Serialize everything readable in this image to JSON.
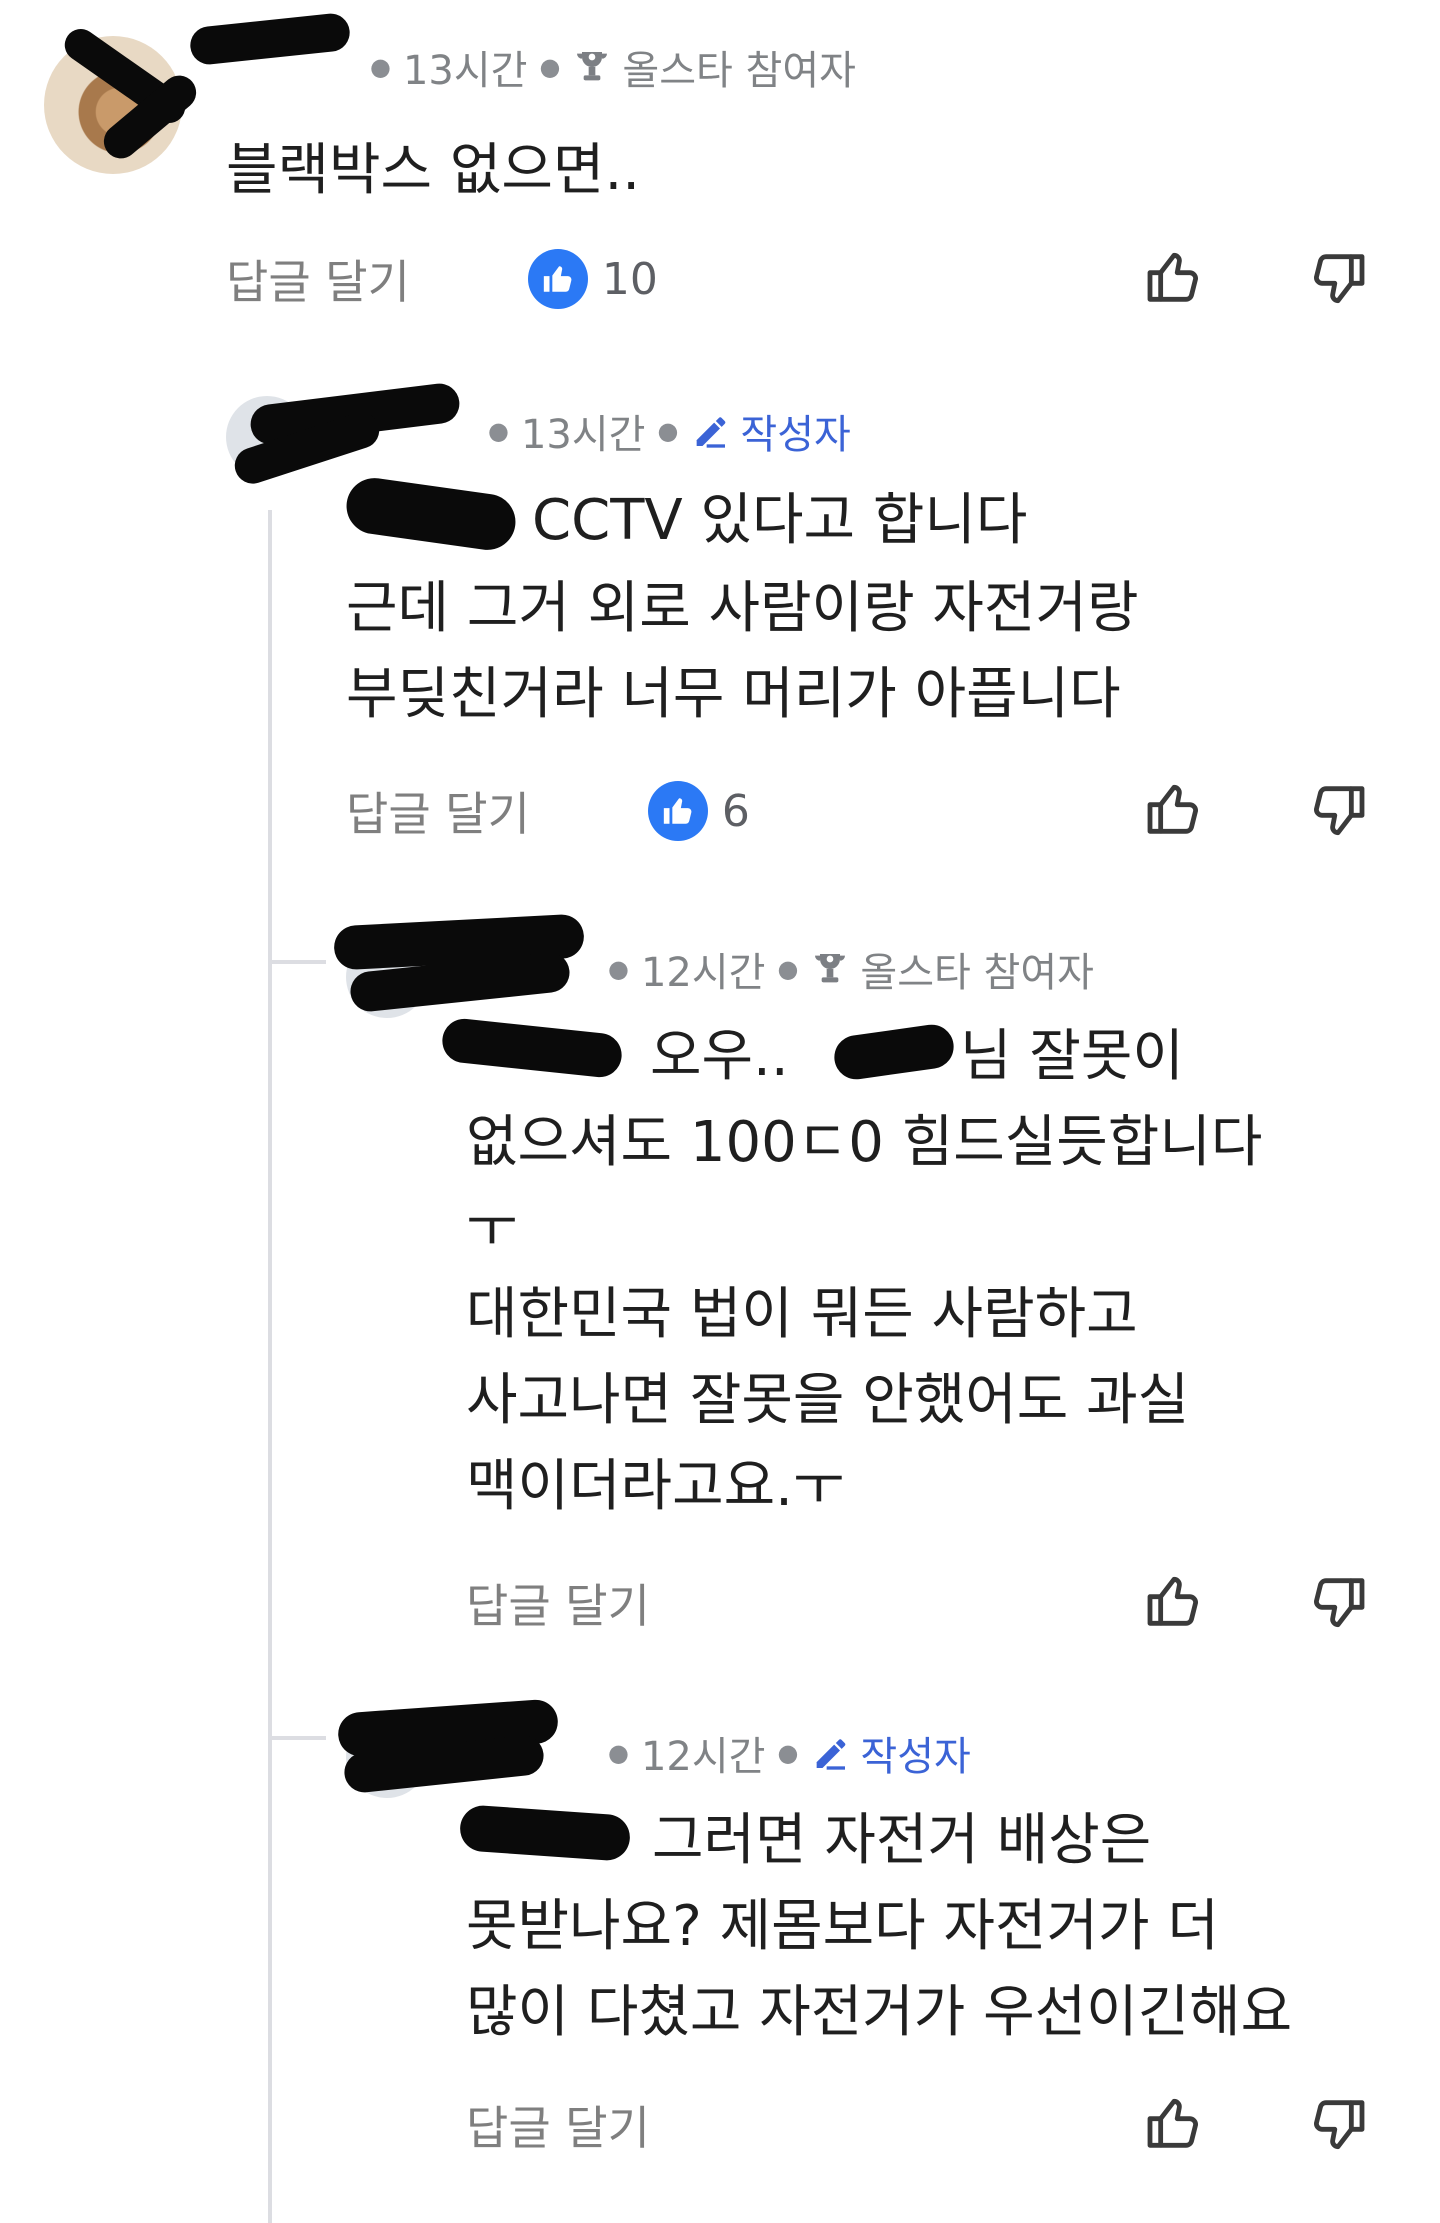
{
  "comments": [
    {
      "time": "13시간",
      "badge": "올스타 참여자",
      "text": "블랙박스 없으면..",
      "reply_label": "답글 달기",
      "likes": "10"
    },
    {
      "time": "13시간",
      "badge": "작성자",
      "mention": "",
      "text_line1": "CCTV 있다고 합니다￼",
      "text_rest": "근데 그거 외로 사람이랑 자전거랑\n부딪친거라 너무 머리가 아픕니다",
      "reply_label": "답글 달기",
      "likes": "6"
    },
    {
      "time": "12시간",
      "badge": "올스타 참여자",
      "text_line1": "오우..",
      "text_line1_suffix": "님 잘못이",
      "text_rest": "없으셔도 100ㄷ0 힘드실듯합니다\nㅜ\n대한민국 법이 뭐든 사람하고\n사고나면 잘못을 안했어도 과실\n맥이더라고요.ㅜ",
      "reply_label": "답글 달기"
    },
    {
      "time": "12시간",
      "badge": "작성자",
      "text_line1": "그러면 자전거 배상은",
      "text_rest": "못받나요? 제몸보다 자전거가 더\n많이 다쳤고 자전거가 우선이긴해요",
      "reply_label": "답글 달기"
    }
  ],
  "colors": {
    "accent": "#3b63d6",
    "like_blue": "#2b79f5",
    "meta_gray": "#808386",
    "thread_line": "#dcdde2"
  },
  "icons": {
    "trophy": "trophy-icon",
    "pencil": "pencil-icon",
    "thumbs_up": "thumbs-up-icon",
    "thumbs_down": "thumbs-down-icon"
  }
}
